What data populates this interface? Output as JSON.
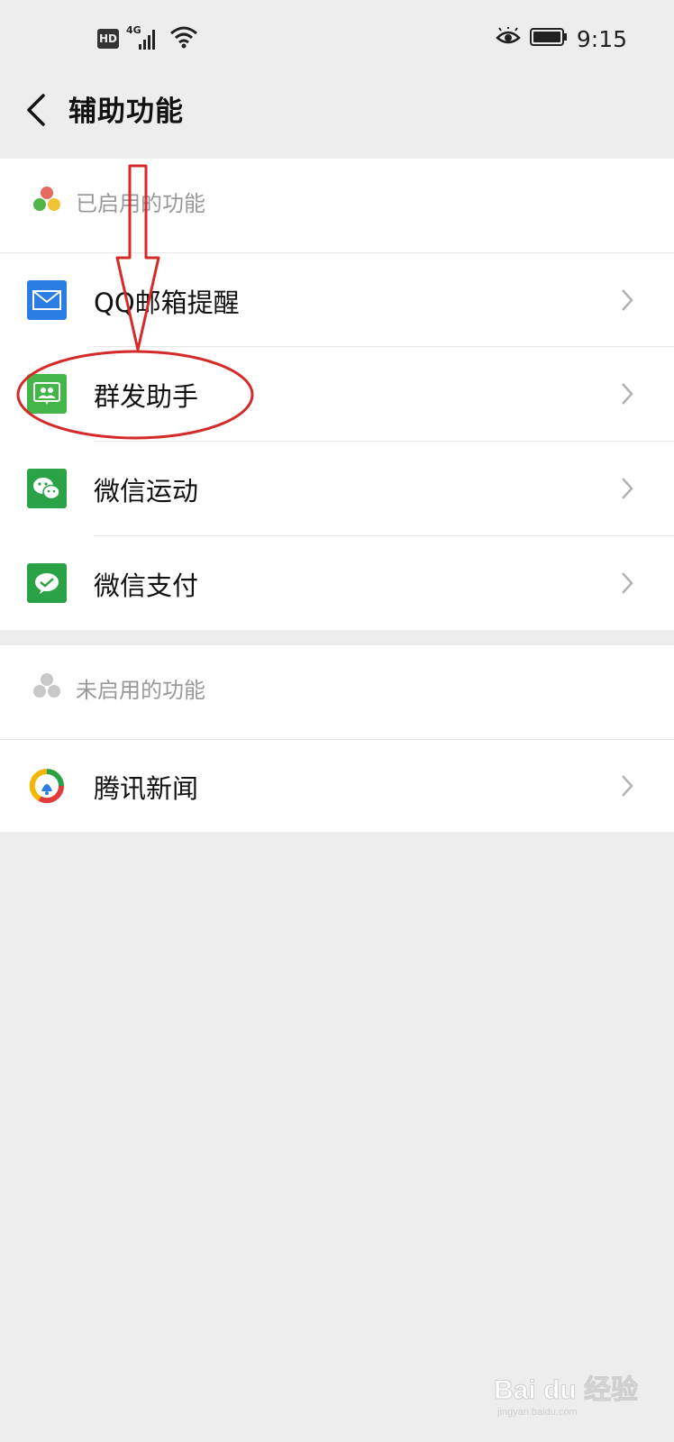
{
  "status_bar": {
    "hd_label": "HD",
    "network_label": "4G",
    "time": "9:15"
  },
  "header": {
    "title": "辅助功能"
  },
  "enabled_section": {
    "label": "已启用的功能",
    "items": [
      {
        "label": "QQ邮箱提醒",
        "icon": "mail-icon",
        "color": "#2a7ee3"
      },
      {
        "label": "群发助手",
        "icon": "group-message-icon",
        "color": "#44b549"
      },
      {
        "label": "微信运动",
        "icon": "wechat-icon",
        "color": "#2ba245"
      },
      {
        "label": "微信支付",
        "icon": "wechat-pay-icon",
        "color": "#2ba245"
      }
    ]
  },
  "disabled_section": {
    "label": "未启用的功能",
    "items": [
      {
        "label": "腾讯新闻",
        "icon": "tencent-news-icon"
      }
    ]
  },
  "watermark": {
    "text": "Bai du 经验",
    "url": "jingyan.baidu.com"
  },
  "colors": {
    "background": "#ededed",
    "annotation_red": "#d42a2a"
  }
}
